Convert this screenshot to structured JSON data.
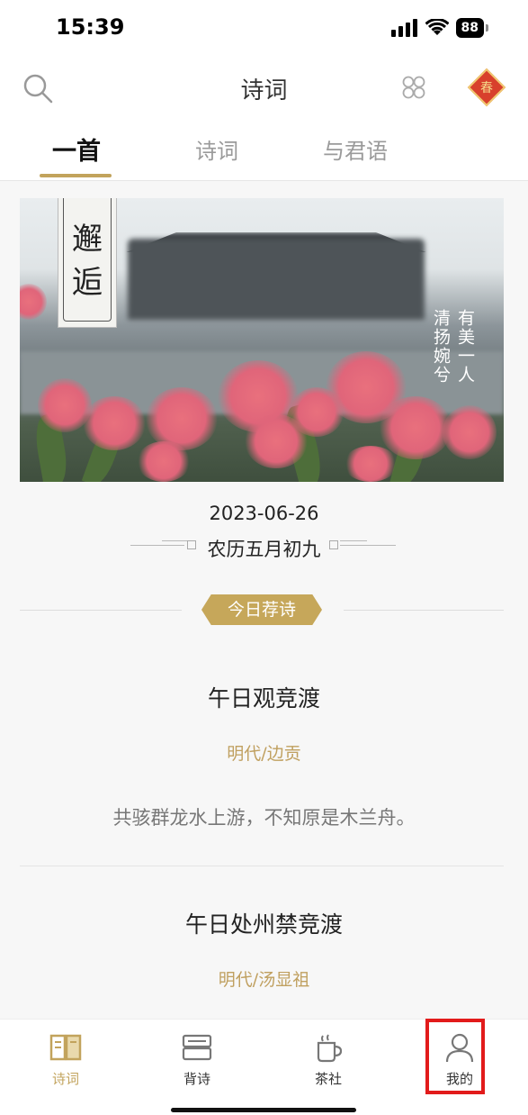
{
  "status_bar": {
    "time": "15:39",
    "battery": "88"
  },
  "header": {
    "title": "诗词",
    "badge_char": "春"
  },
  "tabs": [
    {
      "label": "一首",
      "active": true
    },
    {
      "label": "诗词",
      "active": false
    },
    {
      "label": "与君语",
      "active": false
    }
  ],
  "banner": {
    "seal_title": [
      "邂",
      "逅"
    ],
    "verse_right": "有美一人",
    "verse_left": "清扬婉兮"
  },
  "date": "2023-06-26",
  "lunar_date": "农历五月初九",
  "recommend_label": "今日荐诗",
  "poems": [
    {
      "title": "午日观竞渡",
      "author": "明代/边贡",
      "line": "共骇群龙水上游，不知原是木兰舟。"
    },
    {
      "title": "午日处州禁竞渡",
      "author": "明代/汤显祖"
    }
  ],
  "bottom_nav": [
    {
      "label": "诗词",
      "icon": "book-icon",
      "active": true
    },
    {
      "label": "背诗",
      "icon": "recite-icon",
      "active": false
    },
    {
      "label": "茶社",
      "icon": "cup-icon",
      "active": false
    },
    {
      "label": "我的",
      "icon": "person-icon",
      "active": false
    }
  ],
  "colors": {
    "accent": "#c2a35c",
    "highlight": "#e21b1b",
    "badge_red": "#d8402c"
  }
}
